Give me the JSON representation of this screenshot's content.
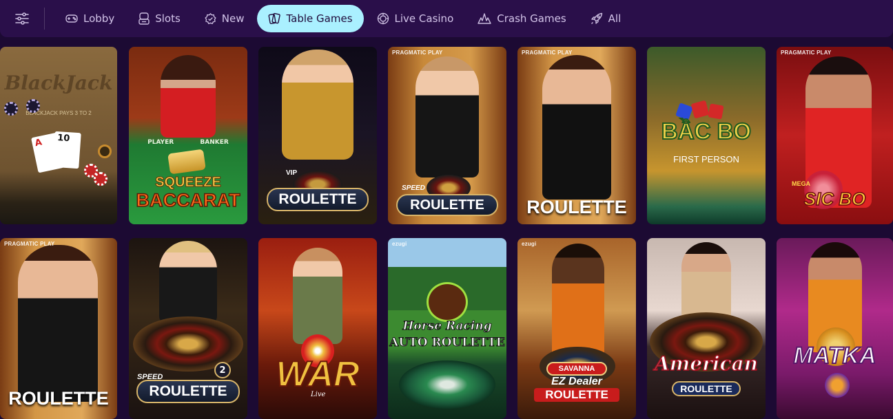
{
  "nav": {
    "filter_icon": "sliders-icon",
    "tabs": [
      {
        "label": "Lobby",
        "icon": "gamepad-icon",
        "active": false
      },
      {
        "label": "Slots",
        "icon": "slot-machine-icon",
        "active": false
      },
      {
        "label": "New",
        "icon": "badge-check-icon",
        "active": false
      },
      {
        "label": "Table Games",
        "icon": "cards-icon",
        "active": true
      },
      {
        "label": "Live Casino",
        "icon": "chip-icon",
        "active": false
      },
      {
        "label": "Crash Games",
        "icon": "crash-icon",
        "active": false
      },
      {
        "label": "All",
        "icon": "rocket-icon",
        "active": false
      }
    ],
    "active_color": "#aaf0ff"
  },
  "games": [
    {
      "title": "BlackJack",
      "subtitle": "BLACKJACK PAYS 3 TO 2",
      "card1": "A",
      "card2": "10"
    },
    {
      "title_top": "SQUEEZE",
      "title": "BACCARAT",
      "player": "PLAYER",
      "banker": "BANKER"
    },
    {
      "prefix": "VIP",
      "title": "ROULETTE"
    },
    {
      "provider": "PRAGMATIC PLAY",
      "prefix": "SPEED",
      "title": "ROULETTE"
    },
    {
      "provider": "PRAGMATIC PLAY",
      "title": "ROULETTE"
    },
    {
      "title": "BẦC BO",
      "subtitle": "FIRST PERSON"
    },
    {
      "provider": "PRAGMATIC PLAY",
      "prefix": "MEGA",
      "title": "SIC BO"
    },
    {
      "provider": "PRAGMATIC PLAY",
      "title": "ROULETTE"
    },
    {
      "prefix": "SPEED",
      "title": "ROULETTE",
      "badge": "2"
    },
    {
      "title": "WAR",
      "suffix": "Live"
    },
    {
      "provider": "ezugi",
      "title_top": "Horse Racing",
      "title": "AUTO ROULETTE"
    },
    {
      "provider": "ezugi",
      "title_top": "SAVANNA",
      "prefix": "EZ Dealer",
      "title": "ROULETTE"
    },
    {
      "title_top": "American",
      "title": "ROULETTE"
    },
    {
      "title": "MATKA"
    }
  ]
}
